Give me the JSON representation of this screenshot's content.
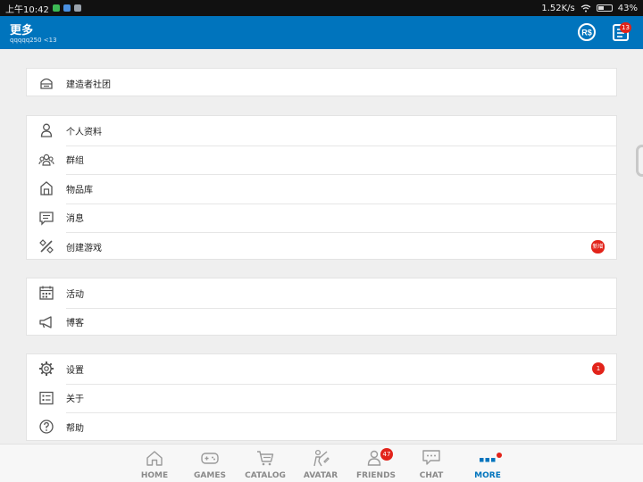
{
  "status_bar": {
    "time": "上午10:42",
    "net_speed": "1.52K/s",
    "battery": "43%",
    "battery_level": 0.43
  },
  "header": {
    "title": "更多",
    "subtitle": "qqqqq250 <13",
    "notification_count": "13"
  },
  "cards": [
    {
      "items": [
        {
          "label": "建造者社团",
          "icon": "builders-club-icon"
        }
      ]
    },
    {
      "items": [
        {
          "label": "个人资料",
          "icon": "profile-icon"
        },
        {
          "label": "群组",
          "icon": "groups-icon"
        },
        {
          "label": "物品库",
          "icon": "inventory-icon"
        },
        {
          "label": "消息",
          "icon": "messages-icon"
        },
        {
          "label": "创建游戏",
          "icon": "create-games-icon",
          "badge": "新增"
        }
      ]
    },
    {
      "items": [
        {
          "label": "活动",
          "icon": "events-icon"
        },
        {
          "label": "博客",
          "icon": "blog-icon"
        }
      ]
    },
    {
      "items": [
        {
          "label": "设置",
          "icon": "settings-icon",
          "badge": "1"
        },
        {
          "label": "关于",
          "icon": "about-icon"
        },
        {
          "label": "帮助",
          "icon": "help-icon"
        }
      ]
    }
  ],
  "bottom_nav": [
    {
      "label": "HOME",
      "icon": "home-icon"
    },
    {
      "label": "GAMES",
      "icon": "games-icon"
    },
    {
      "label": "CATALOG",
      "icon": "catalog-icon"
    },
    {
      "label": "AVATAR",
      "icon": "avatar-icon"
    },
    {
      "label": "FRIENDS",
      "icon": "friends-icon",
      "badge": "47"
    },
    {
      "label": "CHAT",
      "icon": "chat-icon"
    },
    {
      "label": "MORE",
      "icon": "more-icon",
      "active": true
    }
  ],
  "colors": {
    "header_bg": "#0074bd",
    "badge_red": "#e2231a",
    "active_tab": "#0074bd",
    "page_bg": "#efefef"
  }
}
